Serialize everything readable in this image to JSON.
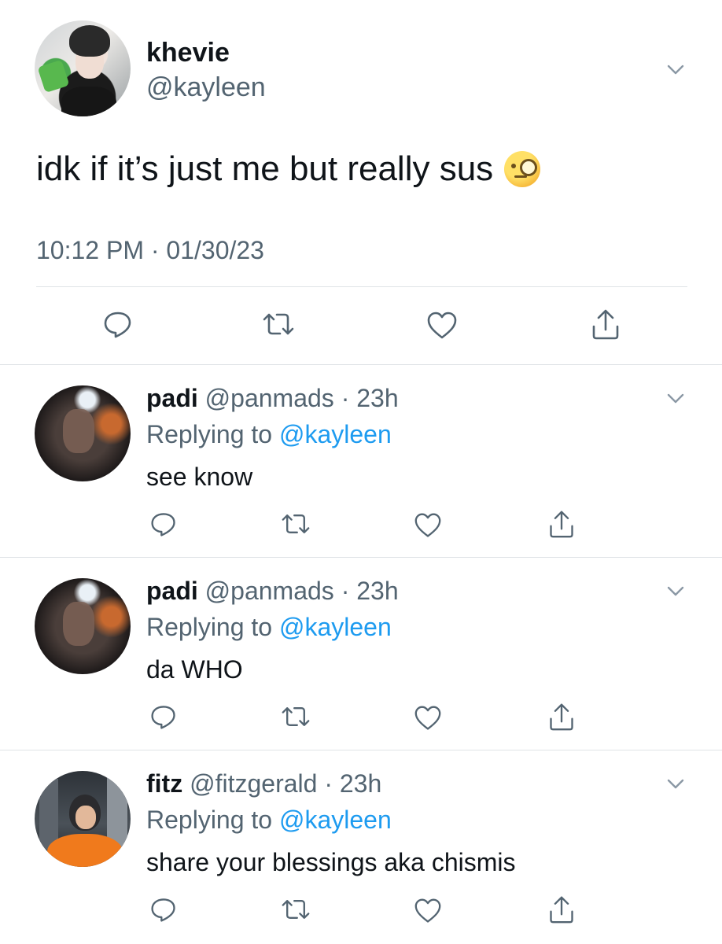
{
  "main_tweet": {
    "author_name": "khevie",
    "author_handle": "@kayleen",
    "text": "idk if it’s just me but really sus",
    "emoji_name": "face-with-monocle",
    "timestamp": "10:12 PM · 01/30/23",
    "actions": [
      "reply-icon",
      "retweet-icon",
      "like-icon",
      "share-icon"
    ]
  },
  "replies": [
    {
      "name": "padi",
      "handle_time": "@panmads · 23h",
      "replying_prefix": "Replying to ",
      "replying_mention": "@kayleen",
      "text": "see know"
    },
    {
      "name": "padi",
      "handle_time": "@panmads · 23h",
      "replying_prefix": "Replying to ",
      "replying_mention": "@kayleen",
      "text": "da WHO"
    },
    {
      "name": "fitz",
      "handle_time": "@fitzgerald · 23h",
      "replying_prefix": "Replying to ",
      "replying_mention": "@kayleen",
      "text": "share your blessings aka chismis"
    }
  ],
  "colors": {
    "text": "#0f1419",
    "secondary": "#536471",
    "link": "#1d9bf0",
    "divider": "#dfe3e6"
  }
}
